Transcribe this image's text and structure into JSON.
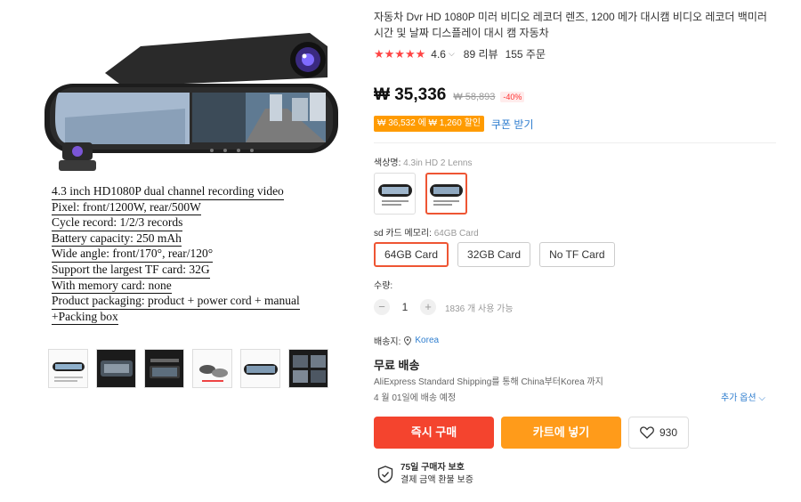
{
  "gallery": {
    "spec_lines": [
      "4.3 inch HD1080P dual channel recording video",
      "Pixel: front/1200W, rear/500W",
      "Cycle record: 1/2/3 records",
      "Battery capacity: 250 mAh",
      "Wide angle: front/170°, rear/120°",
      "Support the largest TF card: 32G",
      "With memory card: none",
      "Product packaging: product + power cord + manual",
      "+Packing box"
    ],
    "thumbnail_count": 6
  },
  "product": {
    "title": "자동차 Dvr HD 1080P 미러 비디오 레코더 렌즈, 1200 메가 대시캠 비디오 레코더 백미러 시간 및 날짜 디스플레이 대시 캠 자동차",
    "stars": "★★★★★",
    "rating": "4.6",
    "reviews": "89 리뷰",
    "orders": "155 주문"
  },
  "price": {
    "current": "₩ 35,336",
    "original": "₩ 58,893",
    "discount": "-40%",
    "coupon": "₩ 36,532 에 ₩ 1,260 할인",
    "coupon_link": "쿠폰 받기"
  },
  "options": {
    "color_label": "색상명:",
    "color_value": "4.3in HD 2 Lenns",
    "sd_label": "sd 카드 메모리:",
    "sd_value": "64GB Card",
    "sd_options": [
      "64GB Card",
      "32GB Card",
      "No TF Card"
    ]
  },
  "quantity": {
    "label": "수량:",
    "minus": "−",
    "value": "1",
    "plus": "+",
    "stock": "1836 개 사용 가능"
  },
  "shipping": {
    "to_label": "배송지:",
    "to_value": "Korea",
    "free": "무료 배송",
    "detail": "AliExpress Standard Shipping를 통해 China부터Korea 까지",
    "date": "4 월 01일에 배송 예정",
    "more": "추가 옵션 ⌵"
  },
  "actions": {
    "buy": "즉시 구매",
    "cart": "카트에 넣기",
    "wishlist_count": "930"
  },
  "protection": {
    "line1": "75일 구매자 보호",
    "line2": "결제 금액 환불 보증"
  },
  "colors": {
    "accent_red": "#f4442e",
    "accent_orange": "#ff9b1a",
    "link_blue": "#2f7ecf",
    "star_red": "#f44"
  }
}
